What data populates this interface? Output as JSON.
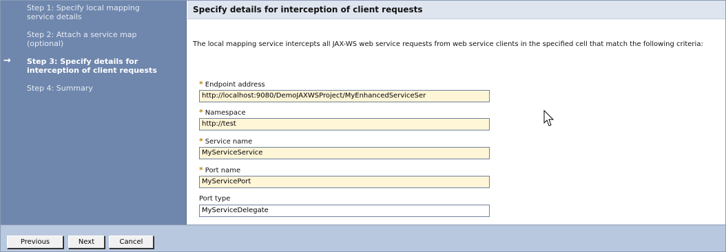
{
  "steps": [
    {
      "label": "Step 1: Specify local mapping service details",
      "current": false
    },
    {
      "label": "Step 2: Attach a service map (optional)",
      "current": false
    },
    {
      "label": "Step 3: Specify details for interception of client requests",
      "current": true
    },
    {
      "label": "Step 4: Summary",
      "current": false
    }
  ],
  "current_step_marker": "→",
  "header": {
    "title": "Specify details for interception of client requests"
  },
  "description": "The local mapping service intercepts all JAX-WS web service requests from web service clients in the specified cell that match the following criteria:",
  "required_marker": "*",
  "fields": {
    "endpoint": {
      "label": "Endpoint address",
      "value": "http://localhost:9080/DemoJAXWSProject/MyEnhancedServiceSer",
      "required": true
    },
    "namespace": {
      "label": "Namespace",
      "value": "http://test",
      "required": true
    },
    "service_name": {
      "label": "Service name",
      "value": "MyServiceService",
      "required": true
    },
    "port_name": {
      "label": "Port name",
      "value": "MyServicePort",
      "required": true
    },
    "port_type": {
      "label": "Port type",
      "value": "MyServiceDelegate",
      "required": false
    }
  },
  "buttons": {
    "previous": "Previous",
    "next": "Next",
    "cancel": "Cancel"
  },
  "colors": {
    "sidebar": "#6f87ad",
    "header": "#dfe5ef",
    "footer": "#b8c8de",
    "required_field": "#fff5d7"
  }
}
